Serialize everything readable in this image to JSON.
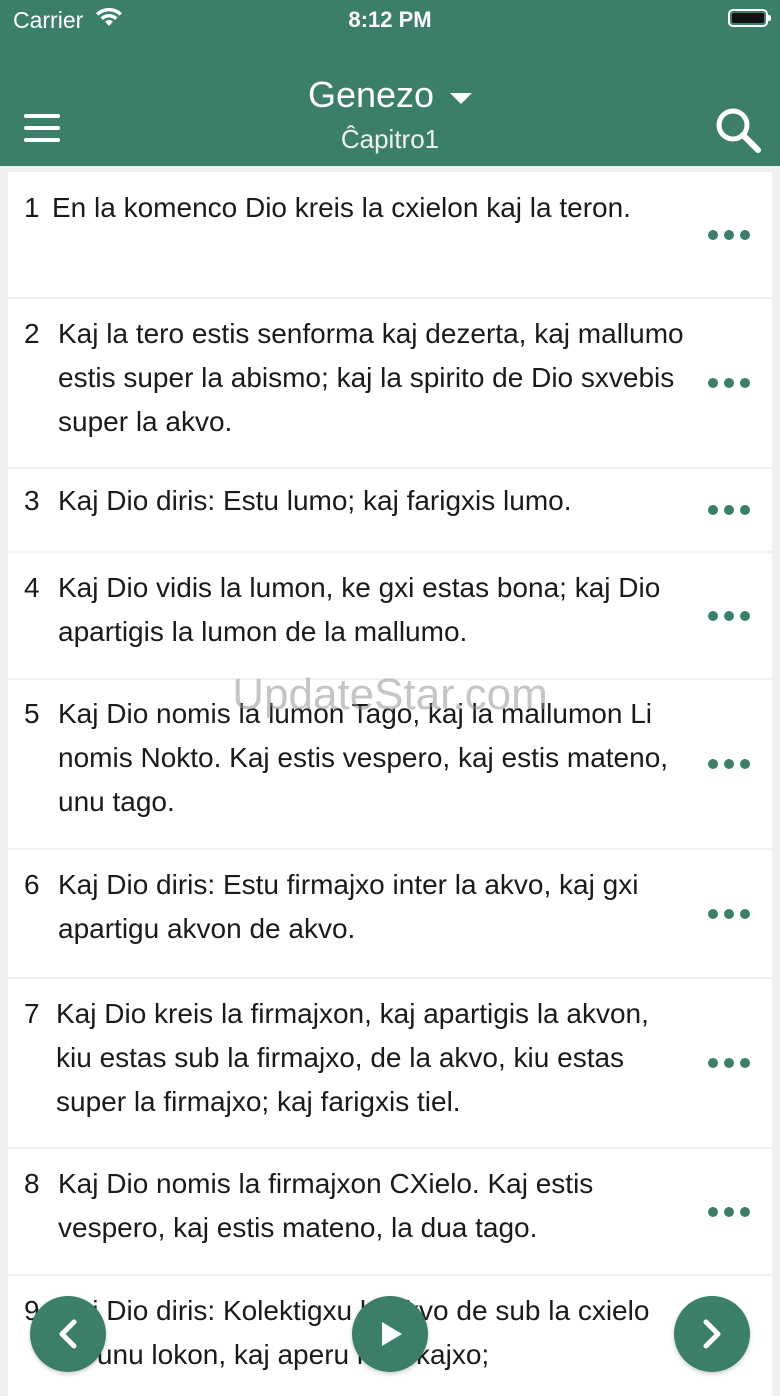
{
  "status_bar": {
    "carrier": "Carrier",
    "time": "8:12 PM"
  },
  "header": {
    "book_title": "Genezo",
    "chapter_label": "Ĉapitro1"
  },
  "watermark": "UpdateStar.com",
  "verses": [
    {
      "number": "1",
      "text": "En la komenco Dio kreis la cxielon kaj la teron."
    },
    {
      "number": "2",
      "text": "Kaj la tero estis senforma kaj dezerta, kaj mallumo estis super la abismo; kaj la spirito de Dio sxvebis super la akvo."
    },
    {
      "number": "3",
      "text": "Kaj Dio diris: Estu lumo; kaj farigxis lumo."
    },
    {
      "number": "4",
      "text": "Kaj Dio vidis la lumon, ke gxi estas bona; kaj Dio apartigis la lumon de la mallumo."
    },
    {
      "number": "5",
      "text": "Kaj Dio nomis la lumon Tago, kaj la mallumon Li nomis Nokto. Kaj estis vespero, kaj estis mateno, unu tago."
    },
    {
      "number": "6",
      "text": "Kaj Dio diris: Estu firmajxo inter la akvo, kaj gxi apartigu akvon de akvo."
    },
    {
      "number": "7",
      "text": "Kaj Dio kreis la firmajxon, kaj apartigis la akvon, kiu estas sub la firmajxo, de la akvo, kiu estas super la firmajxo; kaj farigxis tiel."
    },
    {
      "number": "8",
      "text": "Kaj Dio nomis la firmajxon CXielo. Kaj estis vespero, kaj estis mateno, la dua tago."
    },
    {
      "number": "9",
      "text": "Kaj Dio diris: Kolektigxu la akvo de sub la cxielo en unu lokon, kaj aperu la sekajxo;"
    }
  ],
  "icons": {
    "menu": "hamburger-icon",
    "search": "search-icon",
    "more": "ellipsis-icon",
    "prev": "chevron-left-icon",
    "play": "play-icon",
    "next": "chevron-right-icon"
  },
  "colors": {
    "accent": "#3b7f66",
    "background": "#f0f0f0"
  }
}
